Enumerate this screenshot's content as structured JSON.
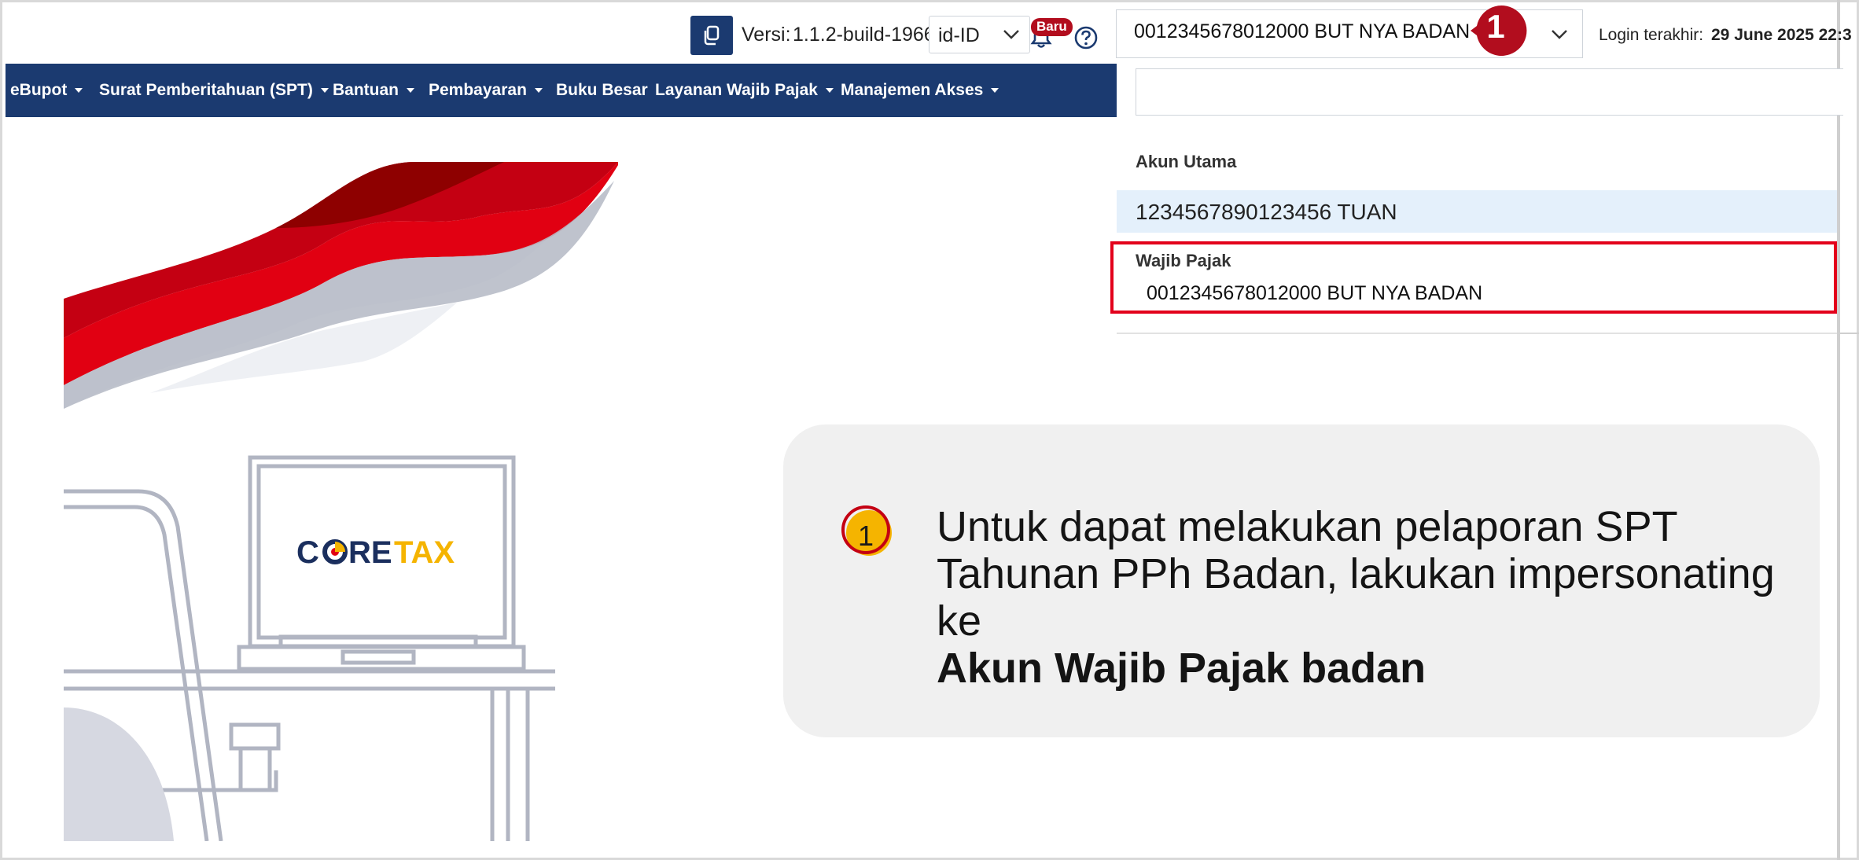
{
  "header": {
    "version_label": "Versi:",
    "version_value": "1.1.2-build-1966",
    "language": "id-ID",
    "new_badge": "Baru",
    "selected_taxpayer": "0012345678012000 BUT NYA BADAN",
    "step_marker": "1",
    "login_label": "Login terakhir:",
    "login_value": "29 June 2025 22:3"
  },
  "nav": {
    "items": [
      {
        "label": "eBupot",
        "dropdown": true
      },
      {
        "label": "Surat Pemberitahuan (SPT)",
        "dropdown": true
      },
      {
        "label": "Bantuan",
        "dropdown": true
      },
      {
        "label": "Pembayaran",
        "dropdown": true
      },
      {
        "label": "Buku Besar",
        "dropdown": false
      },
      {
        "label": "Layanan Wajib Pajak",
        "dropdown": true
      },
      {
        "label": "Manajemen Akses",
        "dropdown": true
      }
    ]
  },
  "dropdown": {
    "search_value": "",
    "primary_label": "Akun Utama",
    "primary_account": "1234567890123456 TUAN",
    "taxpayer_label": "Wajib Pajak",
    "taxpayer_account": "0012345678012000 BUT NYA BADAN"
  },
  "illustration": {
    "logo_part1": "C",
    "logo_part2": "RE",
    "logo_part3": "TAX"
  },
  "callout": {
    "number": "1",
    "text": "Untuk dapat melakukan pelaporan SPT Tahunan PPh Badan, lakukan impersonating ke",
    "bold_text": "Akun Wajib Pajak badan"
  },
  "colors": {
    "navy": "#1b3a70",
    "highlight_red": "#e3001b",
    "badge_red": "#b20d1e",
    "callout_bg": "#f0f0f0",
    "selected_row": "#e4f0fb",
    "logo_yellow": "#f5b400"
  },
  "icons": [
    "copy-icon",
    "chevron-down-icon",
    "bell-icon",
    "help-icon"
  ]
}
